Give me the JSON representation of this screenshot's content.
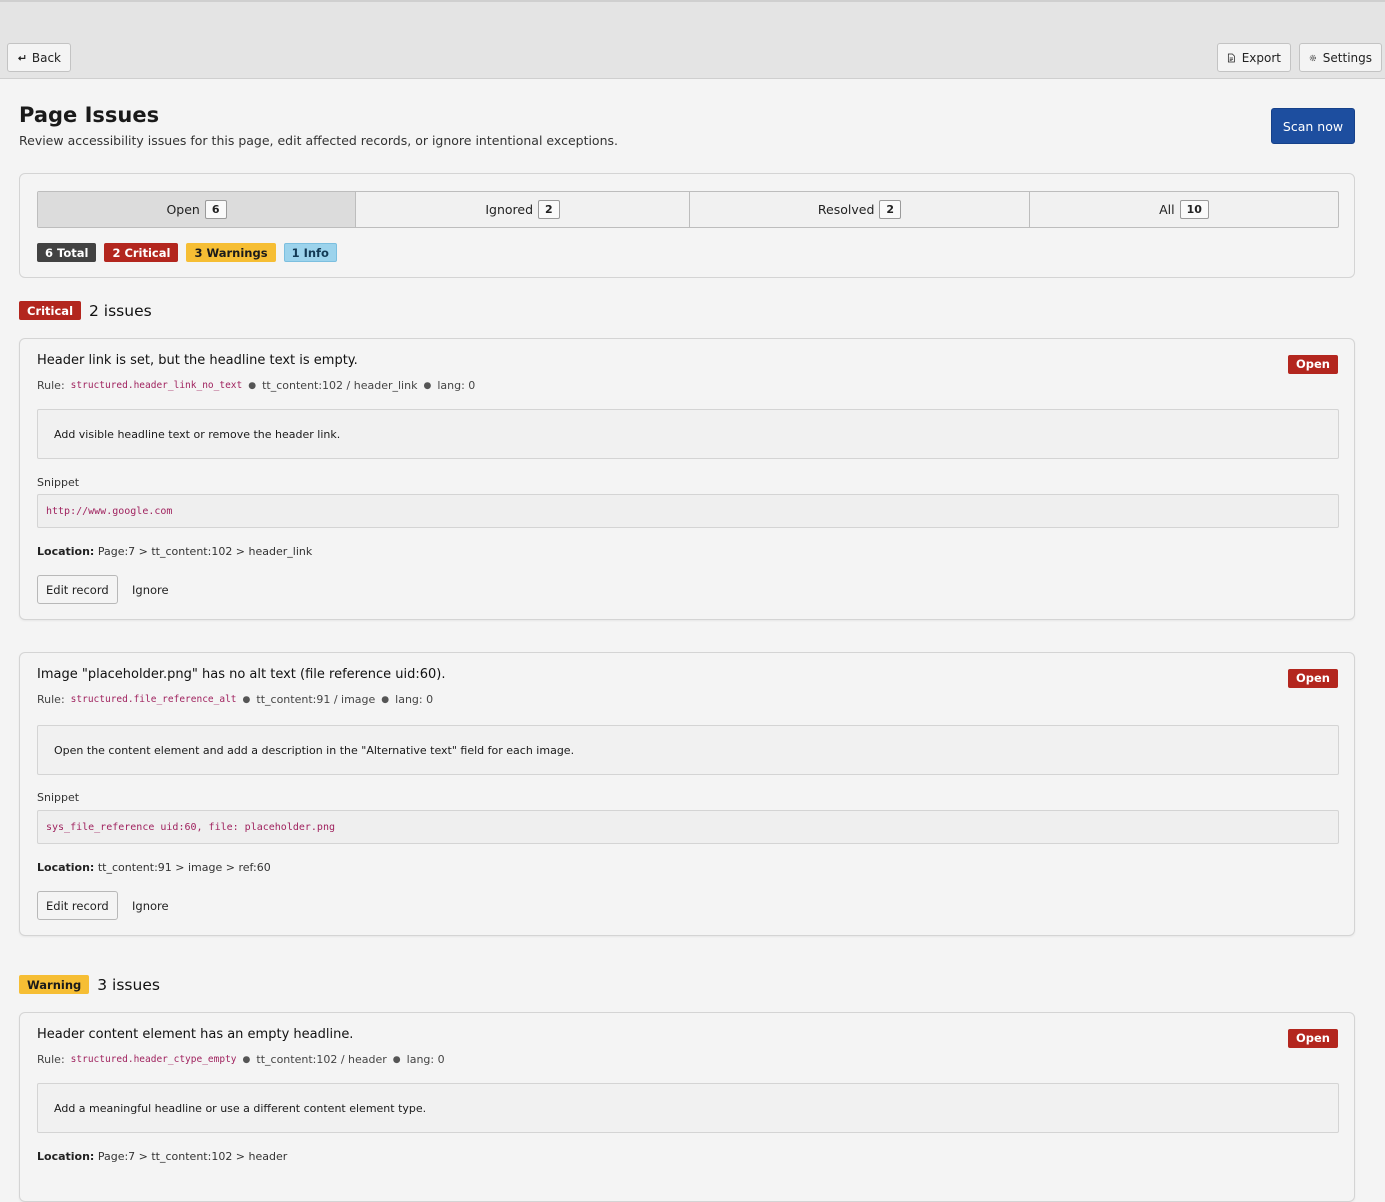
{
  "toolbar": {
    "back_label": "Back",
    "export_label": "Export",
    "settings_label": "Settings"
  },
  "header": {
    "title": "Page Issues",
    "subtitle": "Review accessibility issues for this page, edit affected records, or ignore intentional exceptions.",
    "scan_label": "Scan now"
  },
  "tabs": [
    {
      "label": "Open",
      "count": "6",
      "active": true
    },
    {
      "label": "Ignored",
      "count": "2"
    },
    {
      "label": "Resolved",
      "count": "2"
    },
    {
      "label": "All",
      "count": "10"
    }
  ],
  "summary": {
    "total": "6 Total",
    "critical": "2 Critical",
    "warnings": "3 Warnings",
    "info": "1 Info"
  },
  "groups": [
    {
      "severity": "Critical",
      "count_text": "2 issues"
    },
    {
      "severity": "Warning",
      "count_text": "3 issues"
    }
  ],
  "issues": [
    {
      "title": "Header link is set, but the headline text is empty.",
      "status": "Open",
      "rule_label": "Rule:",
      "rule": "structured.header_link_no_text",
      "record": "tt_content:102 / header_link",
      "lang": "lang: 0",
      "hint": "Add visible headline text or remove the header link.",
      "snippet_label": "Snippet",
      "snippet": "http://www.google.com",
      "location_label": "Location:",
      "location": "Page:7 > tt_content:102 > header_link",
      "edit_label": "Edit record",
      "ignore_label": "Ignore"
    },
    {
      "title": "Image \"placeholder.png\" has no alt text (file reference uid:60).",
      "status": "Open",
      "rule_label": "Rule:",
      "rule": "structured.file_reference_alt",
      "record": "tt_content:91 / image",
      "lang": "lang: 0",
      "hint": "Open the content element and add a description in the \"Alternative text\" field for each image.",
      "snippet_label": "Snippet",
      "snippet": "sys_file_reference uid:60, file: placeholder.png",
      "location_label": "Location:",
      "location": "tt_content:91 > image > ref:60",
      "edit_label": "Edit record",
      "ignore_label": "Ignore"
    },
    {
      "title": "Header content element has an empty headline.",
      "status": "Open",
      "rule_label": "Rule:",
      "rule": "structured.header_ctype_empty",
      "record": "tt_content:102 / header",
      "lang": "lang: 0",
      "hint": "Add a meaningful headline or use a different content element type.",
      "location_label": "Location:",
      "location": "Page:7 > tt_content:102 > header"
    }
  ],
  "colors": {
    "primary": "#1d4e9f",
    "critical": "#b3261e",
    "warning": "#f6be34",
    "info": "#9cd3ec",
    "code": "#a0235f"
  }
}
